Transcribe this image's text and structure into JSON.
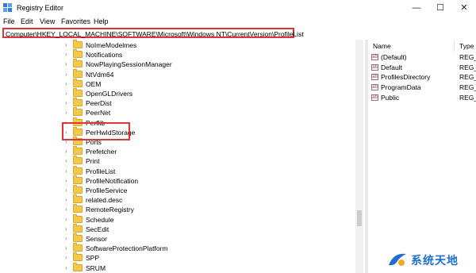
{
  "window": {
    "title": "Registry Editor",
    "minimize_glyph": "—",
    "maximize_glyph": "☐",
    "close_glyph": "✕"
  },
  "menu": [
    "File",
    "Edit",
    "View",
    "Favorites",
    "Help"
  ],
  "address_bar": {
    "path": "Computer\\HKEY_LOCAL_MACHINE\\SOFTWARE\\Microsoft\\Windows NT\\CurrentVersion\\ProfileList"
  },
  "tree": {
    "items": [
      "NoImeModelmes",
      "Notifications",
      "NowPlayingSessionManager",
      "NtVdm64",
      "OEM",
      "OpenGLDrivers",
      "PeerDist",
      "PeerNet",
      "Perflib",
      "PerHwIdStorage",
      "Ports",
      "Prefetcher",
      "Print",
      "ProfileList",
      "ProfileNotification",
      "ProfileService",
      "related.desc",
      "RemoteRegistry",
      "Schedule",
      "SecEdit",
      "Sensor",
      "SoftwareProtectionPlatform",
      "SPP",
      "SRUM"
    ],
    "selected": "ProfileList",
    "expander_glyph": "›"
  },
  "values": {
    "columns": {
      "name": "Name",
      "type": "Type"
    },
    "rows": [
      {
        "name": "(Default)",
        "type": "REG_S"
      },
      {
        "name": "Default",
        "type": "REG_E"
      },
      {
        "name": "ProfilesDirectory",
        "type": "REG_E"
      },
      {
        "name": "ProgramData",
        "type": "REG_E"
      },
      {
        "name": "Public",
        "type": "REG_E"
      }
    ]
  },
  "watermark": {
    "text": "系统天地"
  },
  "colors": {
    "highlight_border": "#e0343b",
    "folder": "#f3c94d",
    "watermark_blue": "#1e6fd0"
  },
  "icons": {
    "app": "registry-editor-icon",
    "folder": "folder-icon",
    "value": "registry-value-icon"
  }
}
